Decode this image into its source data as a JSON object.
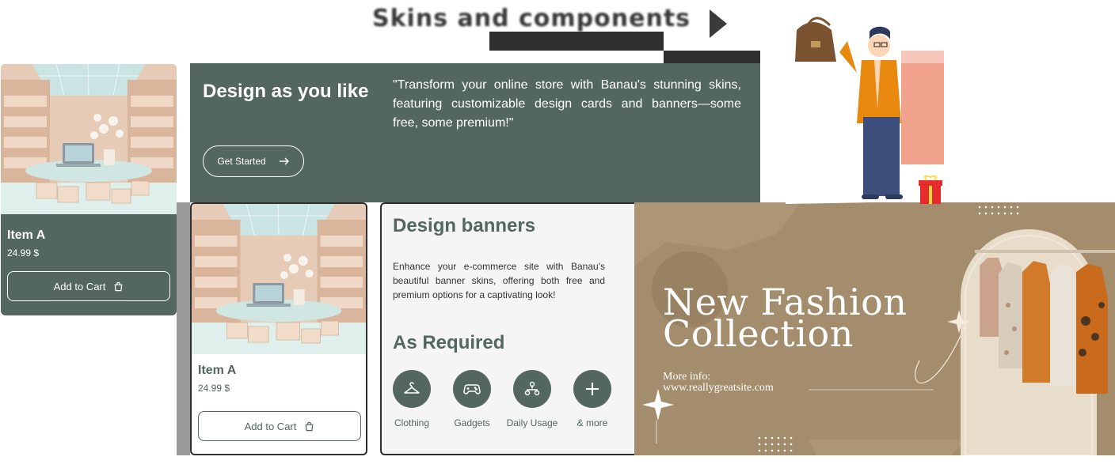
{
  "header": {
    "title": "Skins and components"
  },
  "product_cards": [
    {
      "title": "Item A",
      "price": "24.99 $",
      "cart_label": "Add to Cart"
    },
    {
      "title": "Item A",
      "price": "24.99 $",
      "cart_label": "Add to Cart"
    }
  ],
  "hero": {
    "title": "Design as you like",
    "button_label": "Get Started",
    "quote": "\"Transform your online store with Banau's stunning skins, featuring customizable design cards and banners—some free, some premium!\""
  },
  "banners": {
    "title": "Design banners",
    "description": "Enhance your e-commerce site with Banau's beautiful banner skins, offering both free and premium options for a captivating look!",
    "subtitle": "As Required",
    "categories": [
      {
        "label": "Clothing",
        "icon": "hanger-icon"
      },
      {
        "label": "Gadgets",
        "icon": "gamepad-icon"
      },
      {
        "label": "Daily Usage",
        "icon": "network-icon"
      },
      {
        "label": "& more",
        "icon": "plus-icon"
      }
    ]
  },
  "fashion_banner": {
    "title_line1": "New Fashion",
    "title_line2": "Collection",
    "info_label": "More info:",
    "info_url": "www.reallygreatsite.com"
  },
  "colors": {
    "primary": "#536660",
    "banner_bg": "#a38d6c",
    "panel_bg": "#f5f5f5",
    "accent_orange": "#e8890e"
  }
}
